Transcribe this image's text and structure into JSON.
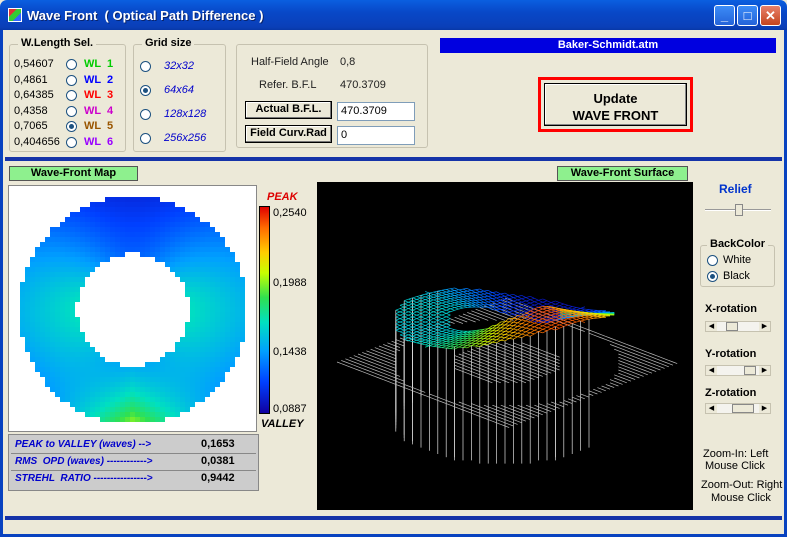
{
  "window": {
    "title": "Wave Front  ( Optical Path Difference )",
    "minimize": "_",
    "maximize": "□",
    "close": "✕"
  },
  "wavelength": {
    "title": "W.Length Sel.",
    "selected_index": 4,
    "items": [
      {
        "value": "0,54607",
        "label": "WL  1",
        "color": "#00cc00"
      },
      {
        "value": "0,4861",
        "label": "WL  2",
        "color": "#0000ff"
      },
      {
        "value": "0,64385",
        "label": "WL  3",
        "color": "#ff0000"
      },
      {
        "value": "0,4358",
        "label": "WL  4",
        "color": "#cc00cc"
      },
      {
        "value": "0,7065",
        "label": "WL  5",
        "color": "#995500"
      },
      {
        "value": "0,404656",
        "label": "WL  6",
        "color": "#9900ff"
      }
    ]
  },
  "grid": {
    "title": "Grid size",
    "selected_index": 1,
    "items": [
      "32x32",
      "64x64",
      "128x128",
      "256x256"
    ]
  },
  "info": {
    "half_field_label": "Half-Field Angle",
    "half_field_value": "0,8",
    "refer_bfl_label": "Refer. B.F.L",
    "refer_bfl_value": "470.3709",
    "actual_bfl_button": "Actual B.F.L.",
    "actual_bfl_value": "470.3709",
    "field_curv_button": "Field Curv.Rad",
    "field_curv_value": "0"
  },
  "file_name": "Baker-Schmidt.atm",
  "update_button": {
    "line1": "Update",
    "line2": "WAVE FRONT"
  },
  "map": {
    "title": "Wave-Front  Map",
    "peak_label": "PEAK",
    "valley_label": "VALLEY",
    "scale_values": [
      "0,2540",
      "0,1988",
      "0,1438",
      "0,0887"
    ]
  },
  "stats": [
    {
      "label": "PEAK to VALLEY (waves) -->",
      "value": "0,1653"
    },
    {
      "label": "RMS  OPD (waves) ------------>",
      "value": "0,0381"
    },
    {
      "label": "STREHL  RATIO ---------------->",
      "value": "0,9442"
    }
  ],
  "surface": {
    "title": "Wave-Front Surface"
  },
  "controls": {
    "relief": "Relief",
    "backcolor_title": "BackColor",
    "backcolor_options": [
      "White",
      "Black"
    ],
    "backcolor_selected": 1,
    "x_rotation": "X-rotation",
    "y_rotation": "Y-rotation",
    "z_rotation": "Z-rotation",
    "zoom_in_line1": "Zoom-In: Left",
    "zoom_in_line2": "Mouse  Click",
    "zoom_out_line1": "Zoom-Out: Right",
    "zoom_out_line2": "Mouse  Click"
  }
}
